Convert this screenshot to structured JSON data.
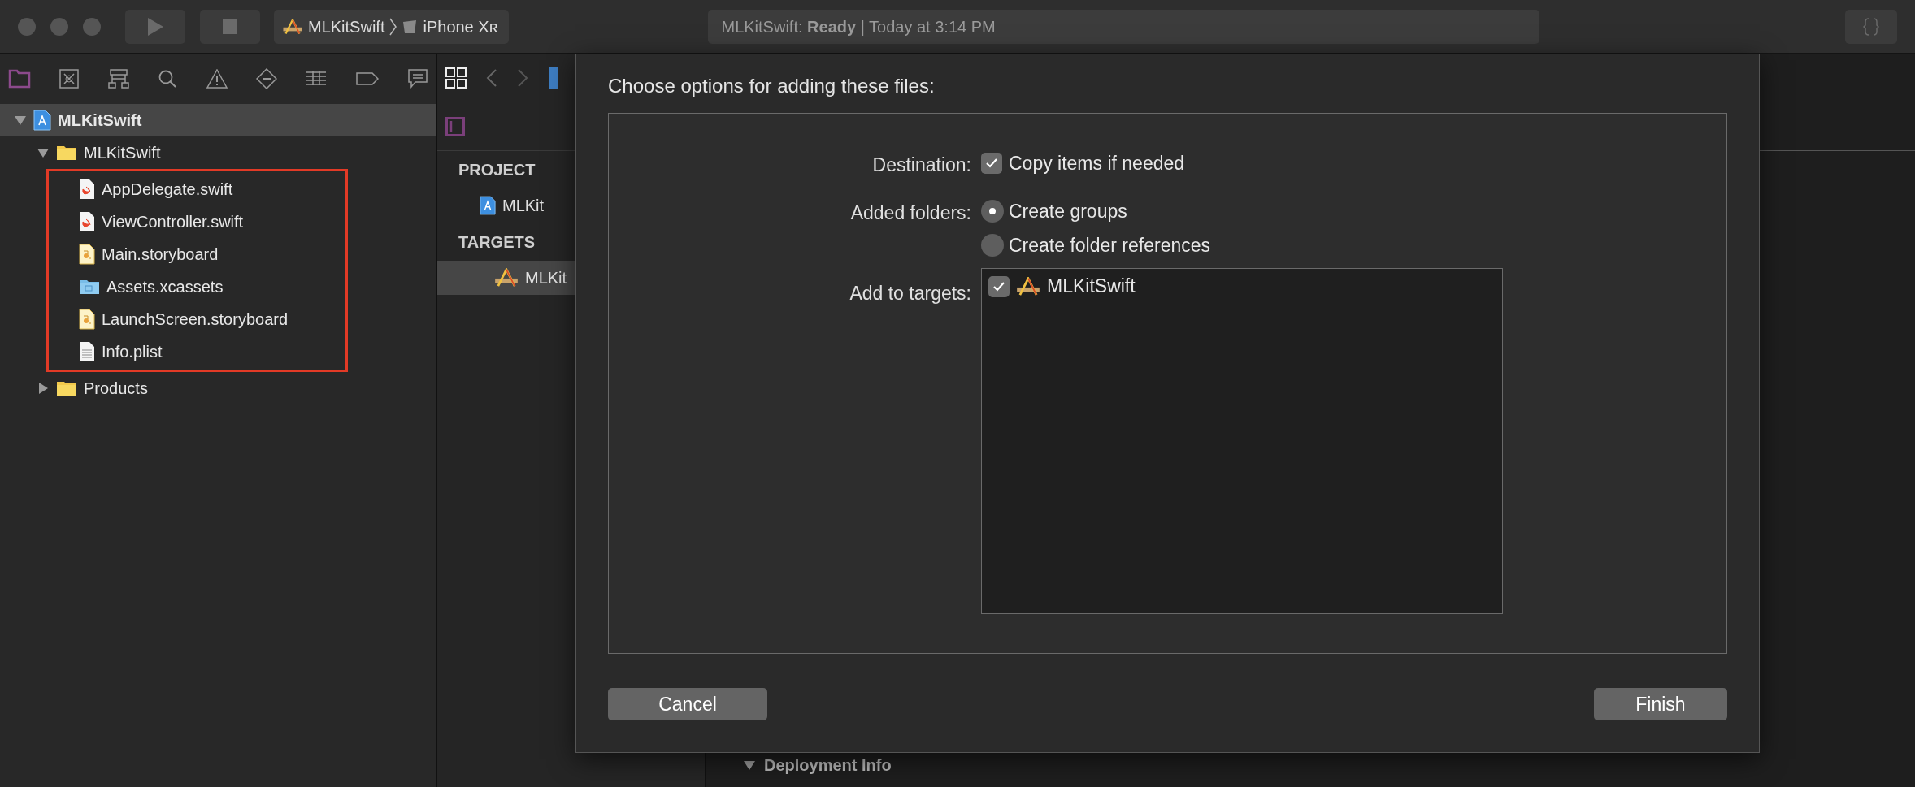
{
  "toolbar": {
    "scheme": {
      "project": "MLKitSwift",
      "device": "iPhone Xʀ"
    },
    "status": "MLKitSwift: **Ready** | Today at 3:14 PM"
  },
  "navigator": {
    "tree": [
      {
        "name": "MLKitSwift",
        "kind": "project",
        "expanded": true,
        "selected": true,
        "children": [
          {
            "name": "MLKitSwift",
            "kind": "folder",
            "expanded": true,
            "selected": false,
            "highlighted": true,
            "children": [
              {
                "name": "AppDelegate.swift",
                "kind": "swift",
                "selected": false
              },
              {
                "name": "ViewController.swift",
                "kind": "swift",
                "selected": false
              },
              {
                "name": "Main.storyboard",
                "kind": "storyboard",
                "selected": false
              },
              {
                "name": "Assets.xcassets",
                "kind": "assets",
                "selected": false
              },
              {
                "name": "LaunchScreen.storyboard",
                "kind": "storyboard",
                "selected": false
              },
              {
                "name": "Info.plist",
                "kind": "plist",
                "selected": false
              }
            ]
          },
          {
            "name": "Products",
            "kind": "folder",
            "expanded": false,
            "selected": false,
            "highlighted": false
          }
        ]
      }
    ]
  },
  "editor": {
    "sections": [
      {
        "header": "PROJECT",
        "items": [
          {
            "name": "MLKit",
            "kind": "project",
            "selected": false
          }
        ]
      },
      {
        "header": "TARGETS",
        "items": [
          {
            "name": "MLKit",
            "kind": "app",
            "selected": true
          }
        ]
      }
    ],
    "section_title": "Deployment Info"
  },
  "dialog": {
    "title": "Choose options for adding these files:",
    "options": [
      {
        "label": "Destination:",
        "kind": "checkbox",
        "choices": [
          {
            "label": "Copy items if needed",
            "checked": true
          }
        ]
      },
      {
        "label": "Added folders:",
        "kind": "radio",
        "choices": [
          {
            "label": "Create groups",
            "selected": true
          },
          {
            "label": "Create folder references",
            "selected": false
          }
        ]
      },
      {
        "label": "Add to targets:",
        "kind": "targets",
        "choices": [
          {
            "label": "MLKitSwift",
            "checked": true
          }
        ]
      }
    ],
    "buttons": [
      {
        "label": "Cancel",
        "kind": "cancel"
      },
      {
        "label": "Finish",
        "kind": "finish"
      }
    ]
  }
}
